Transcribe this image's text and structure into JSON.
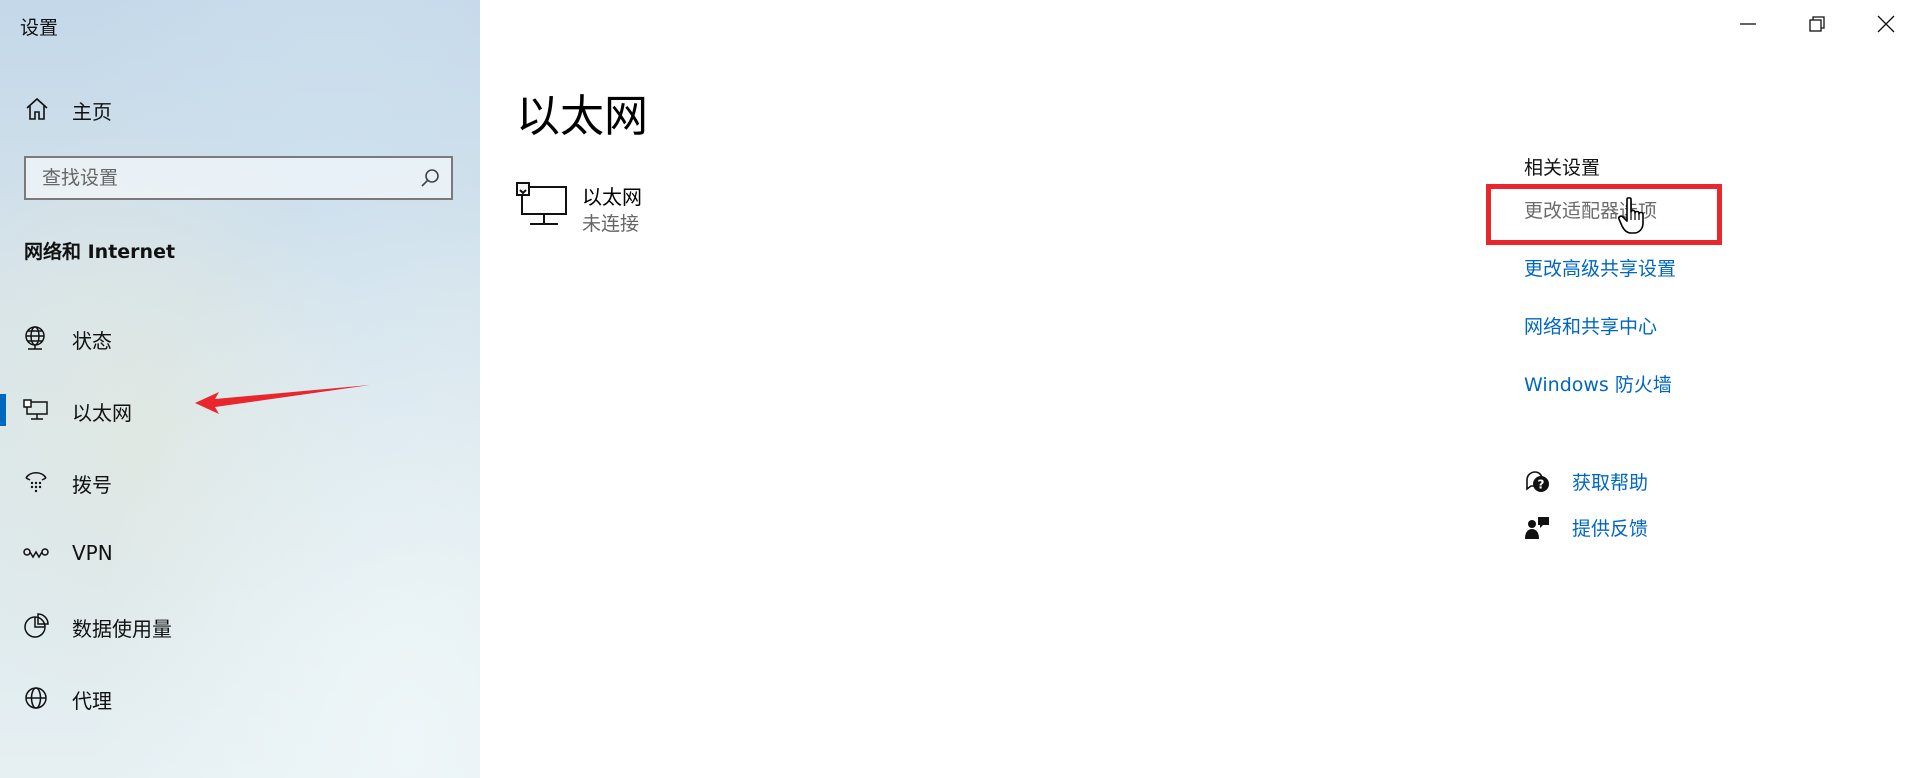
{
  "window": {
    "title": "设置"
  },
  "sidebar": {
    "home_label": "主页",
    "search_placeholder": "查找设置",
    "section_title": "网络和 Internet",
    "items": [
      {
        "label": "状态",
        "icon": "status-globe-icon"
      },
      {
        "label": "以太网",
        "icon": "ethernet-icon",
        "selected": true
      },
      {
        "label": "拨号",
        "icon": "dialup-icon"
      },
      {
        "label": "VPN",
        "icon": "vpn-icon"
      },
      {
        "label": "数据使用量",
        "icon": "data-usage-icon"
      },
      {
        "label": "代理",
        "icon": "proxy-globe-icon"
      }
    ]
  },
  "main": {
    "title": "以太网",
    "adapter": {
      "name": "以太网",
      "status": "未连接",
      "icon": "ethernet-monitor-icon"
    }
  },
  "related": {
    "title": "相关设置",
    "links": [
      {
        "label": "更改适配器选项",
        "state": "hovered"
      },
      {
        "label": "更改高级共享设置"
      },
      {
        "label": "网络和共享中心"
      },
      {
        "label": "Windows 防火墙"
      }
    ]
  },
  "help": {
    "get_help": "获取帮助",
    "feedback": "提供反馈"
  },
  "colors": {
    "accent": "#0067c0",
    "annotation": "#e8262b",
    "hover_link": "#6a6a6a"
  }
}
